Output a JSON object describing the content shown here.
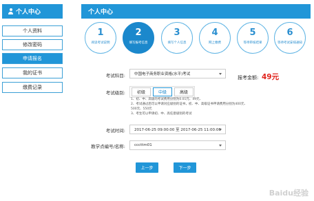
{
  "sidebar": {
    "title": "个人中心",
    "items": [
      {
        "label": "个人资料",
        "active": false
      },
      {
        "label": "修改密码",
        "active": false
      },
      {
        "label": "申请报名",
        "active": true
      },
      {
        "label": "我的证书",
        "active": false
      },
      {
        "label": "缴费记录",
        "active": false
      }
    ]
  },
  "main": {
    "title": "个人中心",
    "steps": [
      {
        "num": "1",
        "label": "阅读考试说明"
      },
      {
        "num": "2",
        "label": "填写报考信息"
      },
      {
        "num": "3",
        "label": "填写个人信息"
      },
      {
        "num": "4",
        "label": "网上缴费"
      },
      {
        "num": "5",
        "label": "等待审核结果"
      },
      {
        "num": "6",
        "label": "等待考试安排通知"
      }
    ],
    "current_step": 2
  },
  "form": {
    "subject_label": "考试科目:",
    "subject_value": "中国电子商务职业资格(水平)考试",
    "fee_label": "报考金额:",
    "fee_value": "49元",
    "level_label": "考试级别:",
    "levels": [
      {
        "label": "初级",
        "active": false
      },
      {
        "label": "中级",
        "active": true
      },
      {
        "label": "高级",
        "active": false
      }
    ],
    "notes": [
      "1、初、中、高级的考试费用分别为0.01元、49元、",
      "2、考试通过后可以申请对应级别的证书，初、中、高级证书申请费用分别为400元、",
      "500元、550元",
      "3、考生可以申请初、中、高任意级别的考试"
    ],
    "time_label": "考试时间:",
    "time_value": "2017-06-25 09:00:00 至 2017-06-25 11:00:00",
    "center_label": "教学点编号/名称:",
    "center_value": "cccttm01"
  },
  "actions": {
    "prev_label": "上一步",
    "next_label": "下一步"
  },
  "watermark": "Baidu经验",
  "colors": {
    "primary": "#2196d8",
    "fee": "#e0221b"
  }
}
